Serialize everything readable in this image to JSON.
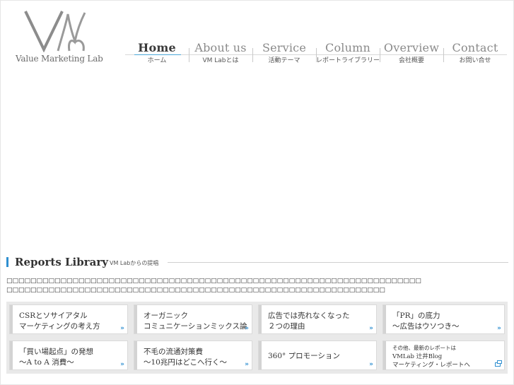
{
  "brand": {
    "logo_text": "Value Marketing Lab",
    "logo_icon": "vm-logo-mark"
  },
  "nav": {
    "items": [
      {
        "en": "Home",
        "jp": "ホーム",
        "active": true
      },
      {
        "en": "About us",
        "jp": "VM Labとは"
      },
      {
        "en": "Service",
        "jp": "活動テーマ"
      },
      {
        "en": "Column",
        "jp": "レポートライブラリー"
      },
      {
        "en": "Overview",
        "jp": "会社概要"
      },
      {
        "en": "Contact",
        "jp": "お問い合せ"
      }
    ]
  },
  "reports": {
    "title": "Reports Library",
    "subtitle": "VM Labからの提唱",
    "intro_line1": "□□□□□□□□□□□□□□□□□□□□□□□□□□□□□□□□□□□□□□□□□□□□□□□□□□□□□□□□□□□□□□□□□□□□□",
    "intro_line2": "□□□□□□□□□□□□□□□□□□□□□□□□□□□□□□□□□□□□□□□□□□□□□□□□□□□□□□□□□□□□□□□",
    "cards": [
      {
        "line1": "CSRとソサイアタル",
        "line2": "マーケティングの考え方",
        "icon": "double-chevron-right-icon"
      },
      {
        "line1": "オーガニック",
        "line2": "コミュニケーションミックス論",
        "icon": "double-chevron-right-icon"
      },
      {
        "line1": "広告では売れなくなった",
        "line2": "２つの理由",
        "icon": "double-chevron-right-icon"
      },
      {
        "line1": "「PR」の底力",
        "line2": "〜広告はウソつき〜",
        "icon": "double-chevron-right-icon"
      },
      {
        "line1": "「買い場起点」の発想",
        "line2": "〜A to A 消費〜",
        "icon": "double-chevron-right-icon"
      },
      {
        "line1": "不毛の流通対策費",
        "line2": "〜10兆円はどこへ行く〜",
        "icon": "double-chevron-right-icon"
      },
      {
        "line1": "360° プロモーション",
        "line2": "",
        "icon": "double-chevron-right-icon"
      },
      {
        "line1": "その他、最新のレポートは",
        "line2": "VMLab 辻井Blog",
        "line3": "マーケティング・レポートへ",
        "icon": "external-link-icon"
      }
    ]
  },
  "arrow_glyph": "»",
  "colors": {
    "accent": "#2f8fd0",
    "nav_active_underline": "#4aa8d8"
  }
}
